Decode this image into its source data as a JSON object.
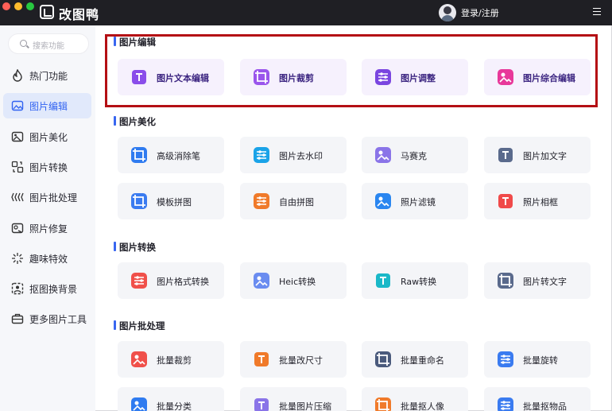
{
  "app": {
    "title": "改图鸭",
    "login": "登录/注册"
  },
  "search": {
    "placeholder": "搜索功能"
  },
  "sidebar": {
    "items": [
      {
        "label": "热门功能",
        "icon": "flame-icon",
        "active": false
      },
      {
        "label": "图片编辑",
        "icon": "image-edit-icon",
        "active": true
      },
      {
        "label": "图片美化",
        "icon": "image-beautify-icon",
        "active": false
      },
      {
        "label": "图片转换",
        "icon": "convert-icon",
        "active": false
      },
      {
        "label": "图片批处理",
        "icon": "batch-icon",
        "active": false
      },
      {
        "label": "照片修复",
        "icon": "photo-repair-icon",
        "active": false
      },
      {
        "label": "趣味特效",
        "icon": "sparkle-icon",
        "active": false
      },
      {
        "label": "抠图换背景",
        "icon": "cutout-icon",
        "active": false
      },
      {
        "label": "更多图片工具",
        "icon": "toolbox-icon",
        "active": false
      }
    ]
  },
  "sections": [
    {
      "title": "图片编辑",
      "cards": [
        {
          "label": "图片文本编辑",
          "icon": "text-edit-icon",
          "color": "#8a4dea"
        },
        {
          "label": "图片裁剪",
          "icon": "crop-icon",
          "color": "#9a55ec"
        },
        {
          "label": "图片调整",
          "icon": "adjust-icon",
          "color": "#7a45e0"
        },
        {
          "label": "图片综合编辑",
          "icon": "comprehensive-edit-icon",
          "color": "#e8389a"
        }
      ]
    },
    {
      "title": "图片美化",
      "cards": [
        {
          "label": "高级消除笔",
          "icon": "eraser-pen-icon",
          "color": "#2f7bf0"
        },
        {
          "label": "图片去水印",
          "icon": "watermark-drop-icon",
          "color": "#1aa3e8"
        },
        {
          "label": "马赛克",
          "icon": "mosaic-icon",
          "color": "#8a74e8"
        },
        {
          "label": "图片加文字",
          "icon": "add-text-icon",
          "color": "#5a6a8c"
        },
        {
          "label": "模板拼图",
          "icon": "template-collage-icon",
          "color": "#3a7bf0"
        },
        {
          "label": "自由拼图",
          "icon": "free-collage-icon",
          "color": "#f07a2a"
        },
        {
          "label": "照片滤镜",
          "icon": "filter-icon",
          "color": "#2a86f0"
        },
        {
          "label": "照片相框",
          "icon": "photo-frame-icon",
          "color": "#f04a4a"
        }
      ]
    },
    {
      "title": "图片转换",
      "cards": [
        {
          "label": "图片格式转换",
          "icon": "format-convert-icon",
          "color": "#f0504a"
        },
        {
          "label": "Heic转换",
          "icon": "heic-icon",
          "color": "#6a8cf0"
        },
        {
          "label": "Raw转换",
          "icon": "raw-icon",
          "color": "#1ab8c8"
        },
        {
          "label": "图片转文字",
          "icon": "image-to-text-icon",
          "color": "#5a6a8c"
        }
      ]
    },
    {
      "title": "图片批处理",
      "cards": [
        {
          "label": "批量裁剪",
          "icon": "batch-crop-icon",
          "color": "#f0504a"
        },
        {
          "label": "批量改尺寸",
          "icon": "batch-resize-icon",
          "color": "#f07a2a"
        },
        {
          "label": "批量重命名",
          "icon": "batch-rename-icon",
          "color": "#4a5a7c"
        },
        {
          "label": "批量旋转",
          "icon": "batch-rotate-icon",
          "color": "#3a7bf0"
        },
        {
          "label": "批量分类",
          "icon": "batch-classify-icon",
          "color": "#2f7bf0"
        },
        {
          "label": "批量图片压缩",
          "icon": "batch-compress-icon",
          "color": "#8a74e8"
        },
        {
          "label": "批量抠人像",
          "icon": "batch-portrait-cutout-icon",
          "color": "#f07a2a"
        },
        {
          "label": "批量抠物品",
          "icon": "batch-object-cutout-icon",
          "color": "#3a7bf0"
        }
      ]
    }
  ]
}
